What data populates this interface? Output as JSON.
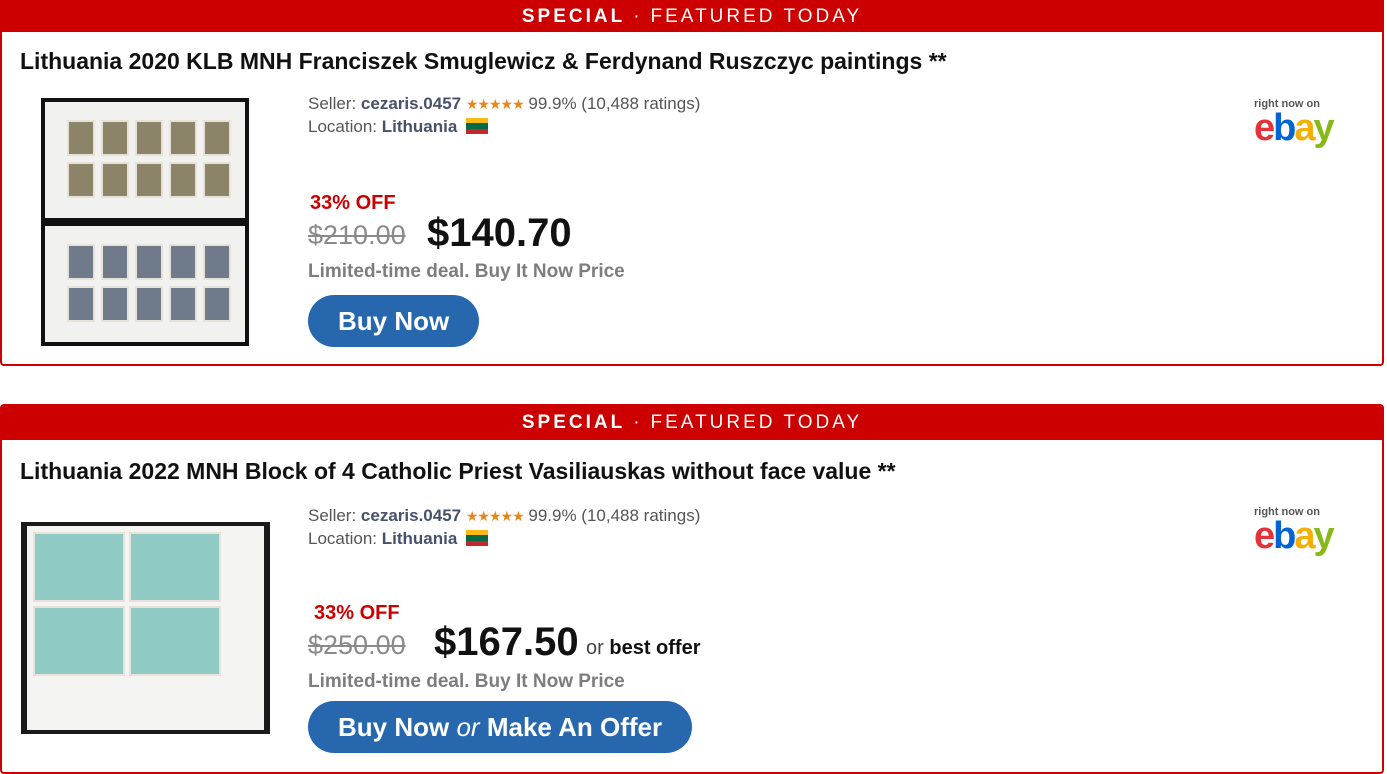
{
  "listings": [
    {
      "banner": {
        "special": "SPECIAL",
        "sep": "·",
        "featured": "FEATURED TODAY"
      },
      "title": "Lithuania 2020 KLB MNH Franciszek Smuglewicz & Ferdynand Ruszczyc paintings **",
      "seller_label": "Seller:",
      "seller_name": "cezaris.0457",
      "stars": "★★★★★",
      "rating": "99.9% (10,488 ratings)",
      "location_label": "Location:",
      "location": "Lithuania",
      "discount": "33% OFF",
      "old_price": "$210.00",
      "price": "$140.70",
      "deal_text": "Limited-time deal. Buy It Now Price",
      "button": {
        "main": "Buy Now"
      },
      "ebay": {
        "right_now": "right now on"
      }
    },
    {
      "banner": {
        "special": "SPECIAL",
        "sep": "·",
        "featured": "FEATURED TODAY"
      },
      "title": "Lithuania 2022 MNH Block of 4 Catholic Priest Vasiliauskas without face value **",
      "seller_label": "Seller:",
      "seller_name": "cezaris.0457",
      "stars": "★★★★★",
      "rating": "99.9% (10,488 ratings)",
      "location_label": "Location:",
      "location": "Lithuania",
      "discount": "33% OFF",
      "old_price": "$250.00",
      "price": "$167.50",
      "or_label": "or",
      "best_offer": "best offer",
      "deal_text": "Limited-time deal. Buy It Now Price",
      "button": {
        "main": "Buy Now",
        "or": "or",
        "offer": "Make An Offer"
      },
      "ebay": {
        "right_now": "right now on"
      }
    }
  ],
  "colors": {
    "accent_red": "#cc0000",
    "button_blue": "#2667ad",
    "flag": [
      "#fdb913",
      "#006a44",
      "#c1272d"
    ]
  }
}
